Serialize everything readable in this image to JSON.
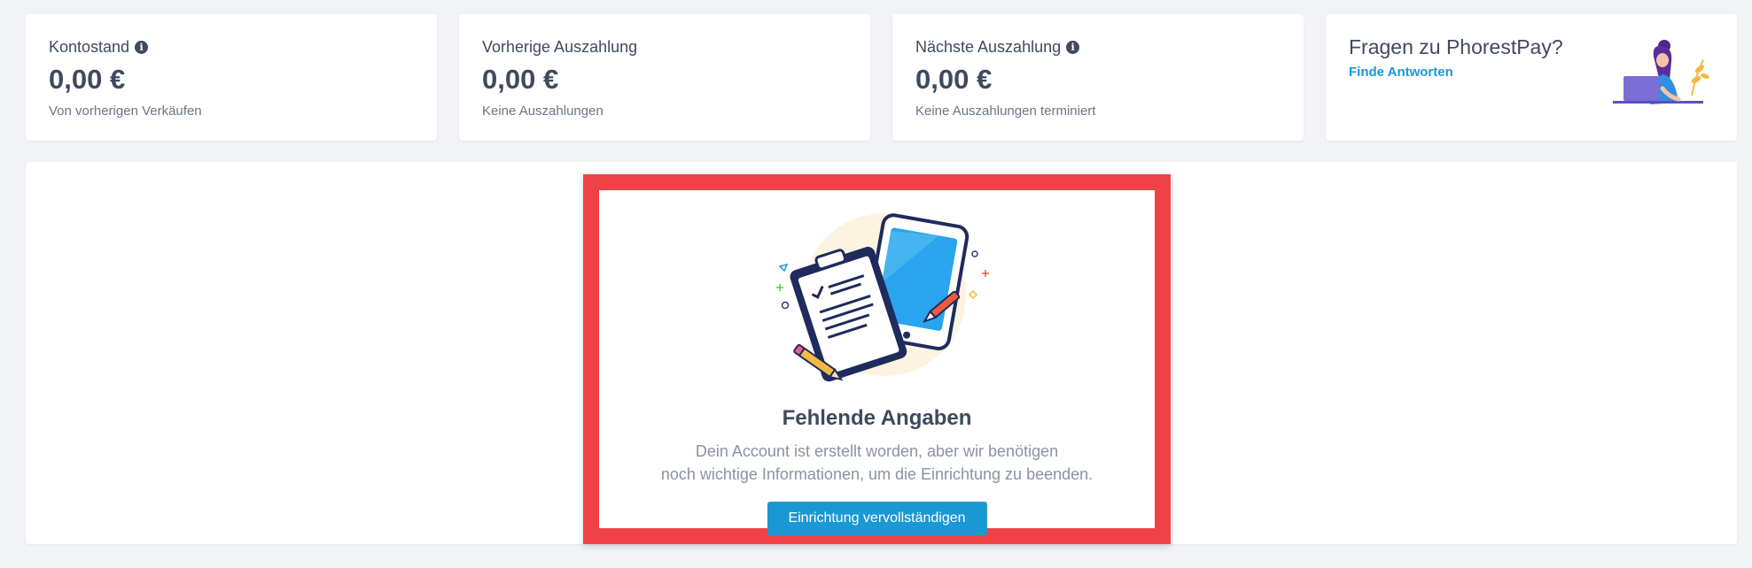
{
  "stats": [
    {
      "label": "Kontostand",
      "has_info": true,
      "value": "0,00 €",
      "sub": "Von vorherigen Verkäufen"
    },
    {
      "label": "Vorherige Auszahlung",
      "has_info": false,
      "value": "0,00 €",
      "sub": "Keine Auszahlungen"
    },
    {
      "label": "Nächste Auszahlung",
      "has_info": true,
      "value": "0,00 €",
      "sub": "Keine Auszahlungen terminiert"
    }
  ],
  "help": {
    "title": "Fragen zu PhorestPay?",
    "link": "Finde Antworten"
  },
  "empty_state": {
    "title": "Fehlende Angaben",
    "line1": "Dein Account ist erstellt worden, aber wir benötigen",
    "line2": "noch wichtige Informationen, um die Einrichtung zu beenden.",
    "button": "Einrichtung vervollständigen"
  },
  "icons": {
    "info": "info-icon",
    "illustration": "clipboard-tablet-illustration",
    "help": "woman-laptop-illustration"
  },
  "colors": {
    "accent": "#1a98d4",
    "highlight": "#f04246",
    "text": "#3e4a5e",
    "background": "#f2f3f6"
  }
}
